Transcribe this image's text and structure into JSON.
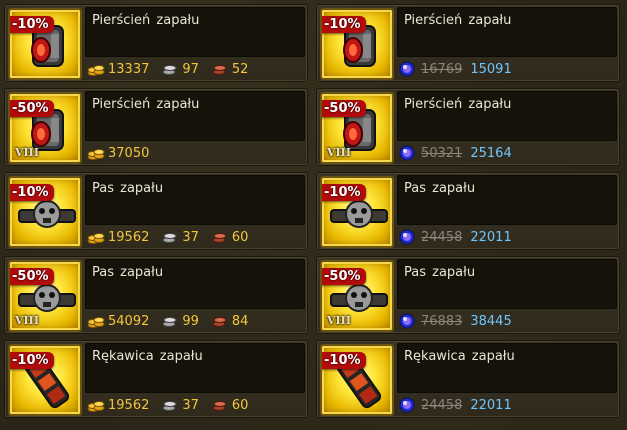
{
  "items": [
    {
      "name": "Pierścień zapału",
      "discount": "-10%",
      "tier": "",
      "icon": "ring-icon",
      "currency": "gold",
      "gold": "13337",
      "silver": "97",
      "bronze": "52"
    },
    {
      "name": "Pierścień zapału",
      "discount": "-10%",
      "tier": "",
      "icon": "ring-icon",
      "currency": "premium",
      "old_price": "16769",
      "new_price": "15091"
    },
    {
      "name": "Pierścień zapału",
      "discount": "-50%",
      "tier": "VIII",
      "icon": "ring-icon",
      "currency": "gold-only",
      "gold": "37050"
    },
    {
      "name": "Pierścień zapału",
      "discount": "-50%",
      "tier": "VIII",
      "icon": "ring-icon",
      "currency": "premium",
      "old_price": "50321",
      "new_price": "25164"
    },
    {
      "name": "Pas zapału",
      "discount": "-10%",
      "tier": "",
      "icon": "belt-icon",
      "currency": "gold",
      "gold": "19562",
      "silver": "37",
      "bronze": "60"
    },
    {
      "name": "Pas zapału",
      "discount": "-10%",
      "tier": "",
      "icon": "belt-icon",
      "currency": "premium",
      "old_price": "24458",
      "new_price": "22011"
    },
    {
      "name": "Pas zapału",
      "discount": "-50%",
      "tier": "VIII",
      "icon": "belt-icon",
      "currency": "gold",
      "gold": "54092",
      "silver": "99",
      "bronze": "84"
    },
    {
      "name": "Pas zapału",
      "discount": "-50%",
      "tier": "VIII",
      "icon": "belt-icon",
      "currency": "premium",
      "old_price": "76883",
      "new_price": "38445"
    },
    {
      "name": "Rękawica zapału",
      "discount": "-10%",
      "tier": "",
      "icon": "gauntlet-icon",
      "currency": "gold",
      "gold": "19562",
      "silver": "37",
      "bronze": "60"
    },
    {
      "name": "Rękawica zapału",
      "discount": "-10%",
      "tier": "",
      "icon": "gauntlet-icon",
      "currency": "premium",
      "old_price": "24458",
      "new_price": "22011"
    }
  ]
}
